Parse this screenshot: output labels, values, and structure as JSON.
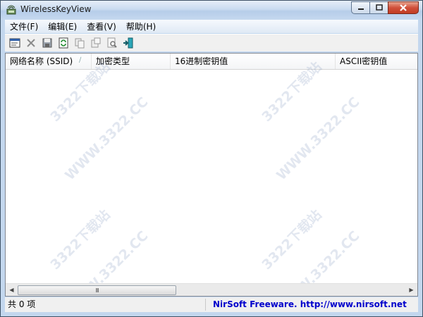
{
  "window": {
    "title": "WirelessKeyView"
  },
  "menu": [
    "文件(F)",
    "编辑(E)",
    "查看(V)",
    "帮助(H)"
  ],
  "toolbar": [
    "properties-icon",
    "delete-icon",
    "save-icon",
    "refresh-icon",
    "copy-icon",
    "copy-key-icon",
    "find-icon",
    "exit-icon"
  ],
  "columns": [
    "网络名称 (SSID)",
    "加密类型",
    "16进制密钥值",
    "ASCII密钥值"
  ],
  "watermarks": [
    "3322下载站",
    "WWW.3322.CC",
    "3322下载站",
    "WWW.3322.CC",
    "3322下载站",
    "WWW.3322.CC",
    "3322下载站",
    "WWW.3322.CC"
  ],
  "scrollbar": {
    "thumb_grip": "III"
  },
  "status": {
    "count": "共 0 项",
    "link": "NirSoft Freeware.  http://www.nirsoft.net"
  },
  "colors": {
    "link": "#0000cc",
    "close_button": "#c13c22"
  }
}
